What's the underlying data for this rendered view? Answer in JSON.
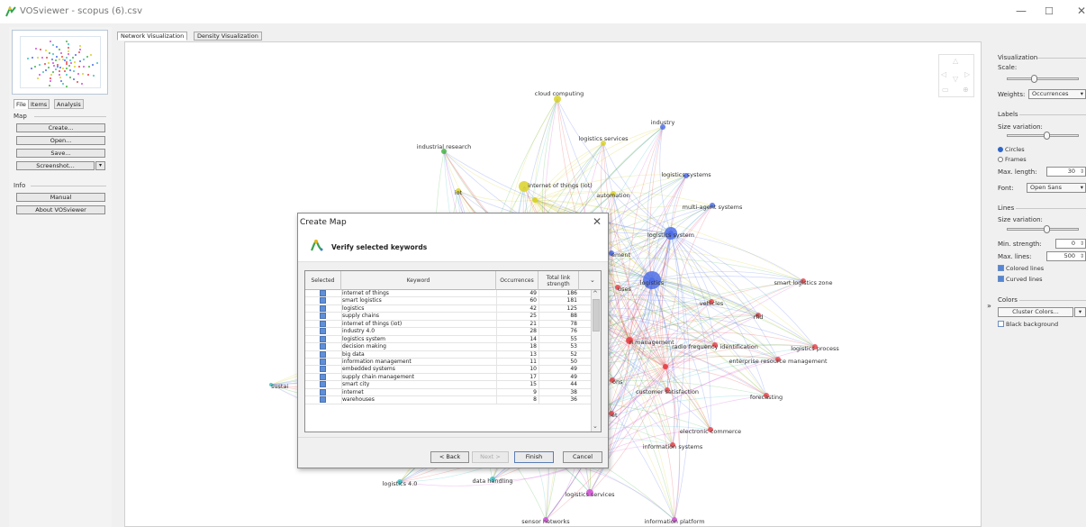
{
  "window": {
    "title": "VOSviewer - scopus (6).csv"
  },
  "left_panel": {
    "tabs": [
      "File",
      "Items",
      "Analysis"
    ],
    "map_section": "Map",
    "map_buttons": [
      "Create...",
      "Open...",
      "Save..."
    ],
    "screenshot_button": "Screenshot...",
    "info_section": "Info",
    "info_buttons": [
      "Manual",
      "About VOSviewer"
    ]
  },
  "main_tabs": [
    "Network Visualization",
    "Density Visualization"
  ],
  "network": {
    "labels": [
      "cloud computing",
      "industry",
      "industrial research",
      "logistics services",
      "logistics systems",
      "internet of things (iot)",
      "iot",
      "automation",
      "multi-agent systems",
      "logistics system",
      "ement",
      "uses",
      "logistics",
      "smart logistics zone",
      "vehicles",
      "rfid",
      "n management",
      "radio frequency identification",
      "logistics process",
      "enterprise resource management",
      "ons",
      "customer satisfaction",
      "forecasting",
      "sustai",
      "et",
      "electronic commerce",
      "information systems",
      "logistics 4.0",
      "data handling",
      "logistics services",
      "sensor networks",
      "information platform"
    ]
  },
  "right_panel": {
    "visualization_section": "Visualization",
    "scale_label": "Scale:",
    "weights_label": "Weights:",
    "weights_value": "Occurrences",
    "labels_section": "Labels",
    "size_variation_label": "Size variation:",
    "circles_label": "Circles",
    "frames_label": "Frames",
    "max_length_label": "Max. length:",
    "max_length_value": "30",
    "font_label": "Font:",
    "font_value": "Open Sans",
    "lines_section": "Lines",
    "lines_size_variation_label": "Size variation:",
    "min_strength_label": "Min. strength:",
    "min_strength_value": "0",
    "max_lines_label": "Max. lines:",
    "max_lines_value": "500",
    "colored_lines_label": "Colored lines",
    "curved_lines_label": "Curved lines",
    "colors_section": "Colors",
    "cluster_colors_button": "Cluster Colors...",
    "black_background_label": "Black background",
    "scale_level": 0.35,
    "label_size_level": 0.55,
    "line_size_level": 0.55
  },
  "dialog": {
    "title": "Create Map",
    "heading": "Verify selected keywords",
    "columns": {
      "selected": "Selected",
      "keyword": "Keyword",
      "occurrences": "Occurrences",
      "tls": "Total link strength"
    },
    "rows": [
      {
        "keyword": "internet of things",
        "occurrences": "49",
        "tls": "186"
      },
      {
        "keyword": "smart logistics",
        "occurrences": "60",
        "tls": "181"
      },
      {
        "keyword": "logistics",
        "occurrences": "42",
        "tls": "125"
      },
      {
        "keyword": "supply chains",
        "occurrences": "25",
        "tls": "88"
      },
      {
        "keyword": "internet of things (iot)",
        "occurrences": "21",
        "tls": "78"
      },
      {
        "keyword": "industry 4.0",
        "occurrences": "28",
        "tls": "76"
      },
      {
        "keyword": "logistics system",
        "occurrences": "14",
        "tls": "55"
      },
      {
        "keyword": "decision making",
        "occurrences": "18",
        "tls": "53"
      },
      {
        "keyword": "big data",
        "occurrences": "13",
        "tls": "52"
      },
      {
        "keyword": "information management",
        "occurrences": "11",
        "tls": "50"
      },
      {
        "keyword": "embedded systems",
        "occurrences": "10",
        "tls": "49"
      },
      {
        "keyword": "supply chain management",
        "occurrences": "17",
        "tls": "49"
      },
      {
        "keyword": "smart city",
        "occurrences": "15",
        "tls": "44"
      },
      {
        "keyword": "internet",
        "occurrences": "9",
        "tls": "38"
      },
      {
        "keyword": "warehouses",
        "occurrences": "8",
        "tls": "36"
      }
    ],
    "buttons": {
      "back": "< Back",
      "next": "Next >",
      "finish": "Finish",
      "cancel": "Cancel"
    }
  },
  "colors": {
    "red": "#e8474c",
    "blue": "#4f6ee8",
    "yellow": "#d9d22a",
    "green": "#47b347",
    "magenta": "#d44fd8",
    "cyan": "#3fc1c4"
  }
}
